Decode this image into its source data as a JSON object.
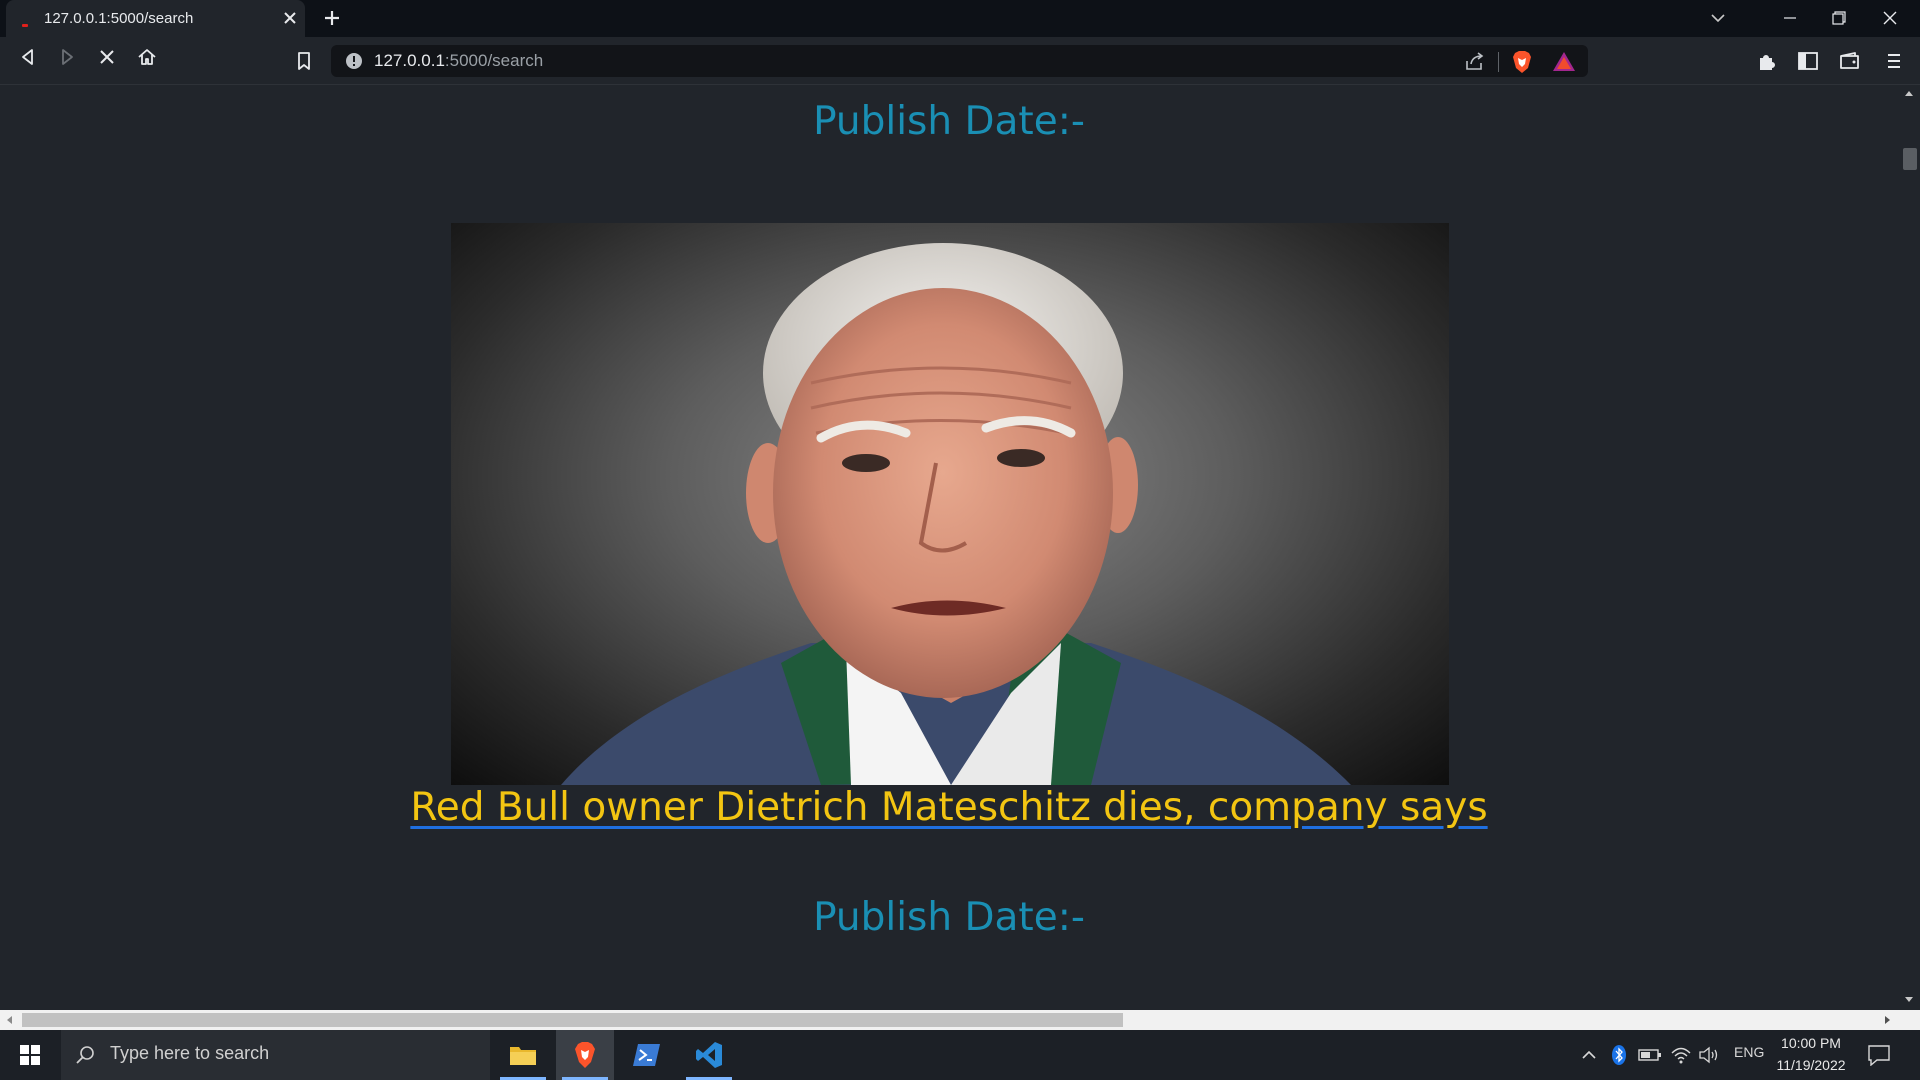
{
  "browser": {
    "tab": {
      "title": "127.0.0.1:5000/search"
    },
    "url": {
      "host": "127.0.0.1",
      "path": ":5000/search"
    }
  },
  "page": {
    "publish_date_1": "Publish Date:-",
    "headline": "Red Bull owner Dietrich Mateschitz dies, company says",
    "publish_date_2": "Publish Date:-"
  },
  "taskbar": {
    "search_placeholder": "Type here to search",
    "language": "ENG",
    "time": "10:00 PM",
    "date": "11/19/2022"
  },
  "colors": {
    "page_bg": "#21252b",
    "publish_date": "#1a8fb4",
    "headline": "#f3c512",
    "link_underline": "#1f6fe0"
  }
}
